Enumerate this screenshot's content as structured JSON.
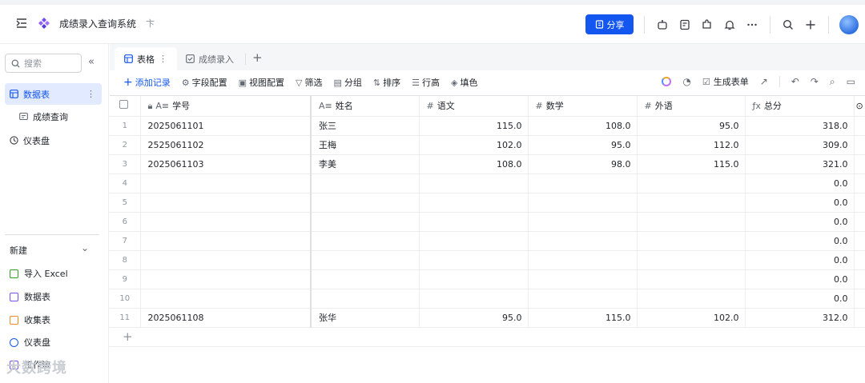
{
  "app": {
    "title": "成绩录入查询系统",
    "pin": "卞"
  },
  "header": {
    "share_label": "分享"
  },
  "sidebar": {
    "search_placeholder": "搜索",
    "items": [
      {
        "label": "数据表"
      },
      {
        "label": "成绩查询"
      },
      {
        "label": "仪表盘"
      }
    ],
    "new_label": "新建",
    "new_items": [
      {
        "label": "导入 Excel"
      },
      {
        "label": "数据表"
      },
      {
        "label": "收集表"
      },
      {
        "label": "仪表盘"
      },
      {
        "label": "工作流"
      }
    ]
  },
  "tabs": [
    {
      "label": "表格"
    },
    {
      "label": "成绩录入"
    }
  ],
  "toolbar": {
    "add_record": "添加记录",
    "field_config": "字段配置",
    "view_config": "视图配置",
    "filter": "筛选",
    "group": "分组",
    "sort": "排序",
    "row_height": "行高",
    "fill_color": "填色",
    "generate_form": "生成表单"
  },
  "table": {
    "columns": [
      "学号",
      "姓名",
      "语文",
      "数学",
      "外语",
      "总分"
    ],
    "rows": [
      [
        "1",
        "2025061101",
        "张三",
        "115.0",
        "108.0",
        "95.0",
        "318.0"
      ],
      [
        "2",
        "2525061102",
        "王梅",
        "102.0",
        "95.0",
        "112.0",
        "309.0"
      ],
      [
        "3",
        "2025061103",
        "李美",
        "108.0",
        "98.0",
        "115.0",
        "321.0"
      ],
      [
        "4",
        "",
        "",
        "",
        "",
        "",
        "0.0"
      ],
      [
        "5",
        "",
        "",
        "",
        "",
        "",
        "0.0"
      ],
      [
        "6",
        "",
        "",
        "",
        "",
        "",
        "0.0"
      ],
      [
        "7",
        "",
        "",
        "",
        "",
        "",
        "0.0"
      ],
      [
        "8",
        "",
        "",
        "",
        "",
        "",
        "0.0"
      ],
      [
        "9",
        "",
        "",
        "",
        "",
        "",
        "0.0"
      ],
      [
        "10",
        "",
        "",
        "",
        "",
        "",
        "0.0"
      ],
      [
        "11",
        "2025061108",
        "张华",
        "95.0",
        "115.0",
        "102.0",
        "312.0"
      ]
    ]
  },
  "watermark": "大数跨境",
  "colors": {
    "accent": "#1456f0",
    "active_bg": "#e1eaff"
  }
}
